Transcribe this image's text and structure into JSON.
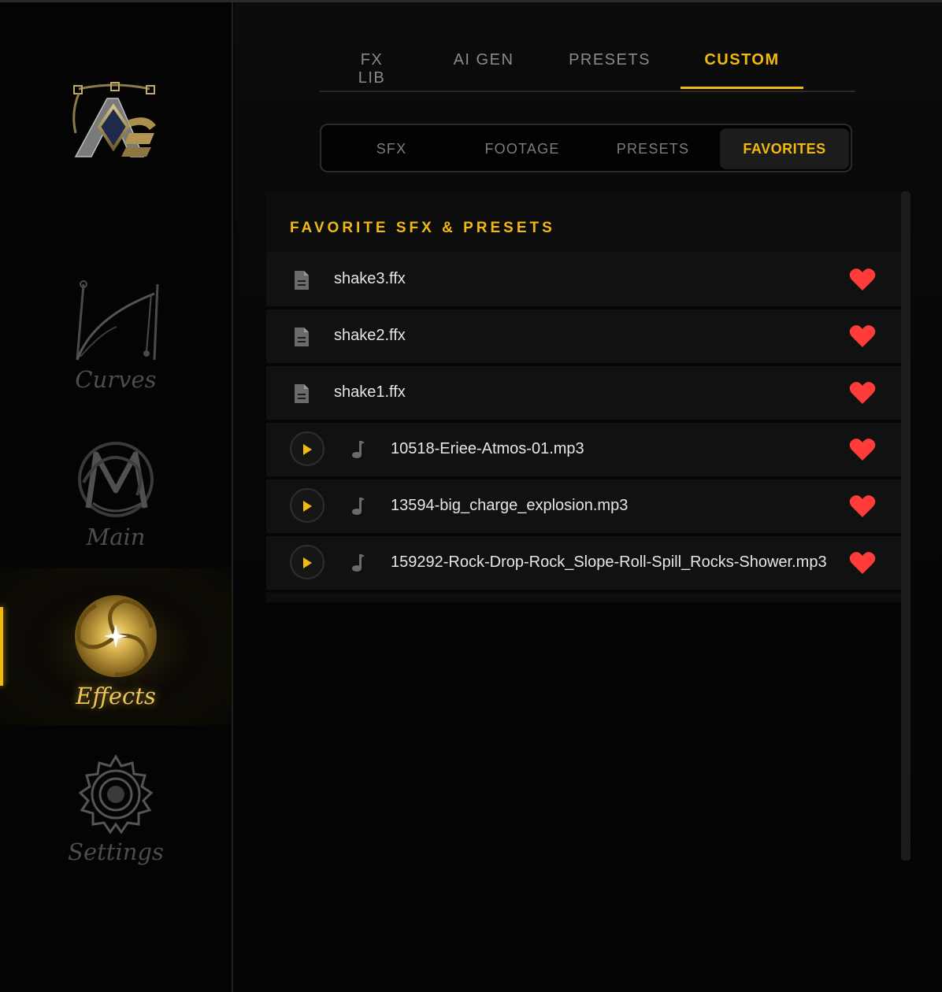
{
  "sidebar": {
    "items": [
      {
        "label": "Curves",
        "icon": "curves-icon"
      },
      {
        "label": "Main",
        "icon": "main-monogram-icon"
      },
      {
        "label": "Effects",
        "icon": "effects-swirl-icon",
        "active": true
      },
      {
        "label": "Settings",
        "icon": "gear-icon"
      }
    ]
  },
  "top_tabs": [
    {
      "label": "FX LIB"
    },
    {
      "label": "AI GEN"
    },
    {
      "label": "PRESETS"
    },
    {
      "label": "CUSTOM",
      "active": true
    }
  ],
  "sub_tabs": [
    {
      "label": "SFX"
    },
    {
      "label": "FOOTAGE"
    },
    {
      "label": "PRESETS"
    },
    {
      "label": "FAVORITES",
      "active": true
    }
  ],
  "favorites": {
    "title": "FAVORITE SFX & PRESETS",
    "items": [
      {
        "name": "shake3.ffx",
        "type": "preset",
        "favorited": true
      },
      {
        "name": "shake2.ffx",
        "type": "preset",
        "favorited": true
      },
      {
        "name": "shake1.ffx",
        "type": "preset",
        "favorited": true
      },
      {
        "name": "10518-Eriee-Atmos-01.mp3",
        "type": "audio",
        "favorited": true
      },
      {
        "name": "13594-big_charge_explosion.mp3",
        "type": "audio",
        "favorited": true
      },
      {
        "name": "159292-Rock-Drop-Rock_Slope-Roll-Spill_Rocks-Shower.mp3",
        "type": "audio",
        "favorited": true
      }
    ]
  },
  "colors": {
    "accent": "#f2b90f",
    "heart": "#ff3b3b",
    "background": "#060606"
  }
}
